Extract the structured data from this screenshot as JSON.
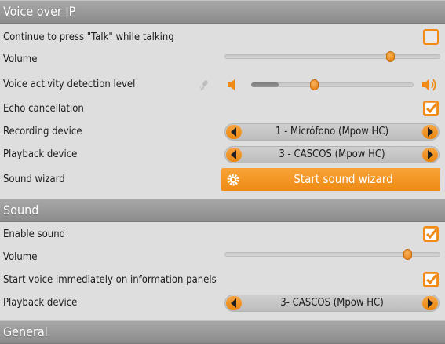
{
  "voip": {
    "title": "Voice over IP",
    "talk_label": "Continue to press \"Talk\" while talking",
    "talk_checked": false,
    "volume_label": "Volume",
    "volume_level": 0.77,
    "vad_label": "Voice activity detection level",
    "vad_level": 0.39,
    "vad_fill": 0.17,
    "echo_label": "Echo cancellation",
    "echo_checked": true,
    "recording_label": "Recording device",
    "recording_value": "1 - Micrófono (Mpow HC)",
    "playback_label": "Playback device",
    "playback_value": "3 - CASCOS (Mpow HC)",
    "wizard_label": "Sound wizard",
    "wizard_button": "Start sound wizard"
  },
  "sound": {
    "title": "Sound",
    "enable_label": "Enable sound",
    "enable_checked": true,
    "volume_label": "Volume",
    "volume_level": 0.85,
    "immediate_label": "Start voice immediately on information panels",
    "immediate_checked": true,
    "playback_label": "Playback device",
    "playback_value": "3- CASCOS (Mpow HC)"
  },
  "general": {
    "title": "General"
  },
  "icons": {
    "checkmark": "checkmark-icon",
    "arrow_left": "arrow-left-icon",
    "arrow_right": "arrow-right-icon",
    "microphone": "microphone-icon",
    "speaker_low": "speaker-low-icon",
    "speaker_high": "speaker-high-icon",
    "wizard": "gear-icon"
  },
  "colors": {
    "accent": "#F0901F",
    "header": "#9A9A9A",
    "background": "#DEDEDE"
  }
}
